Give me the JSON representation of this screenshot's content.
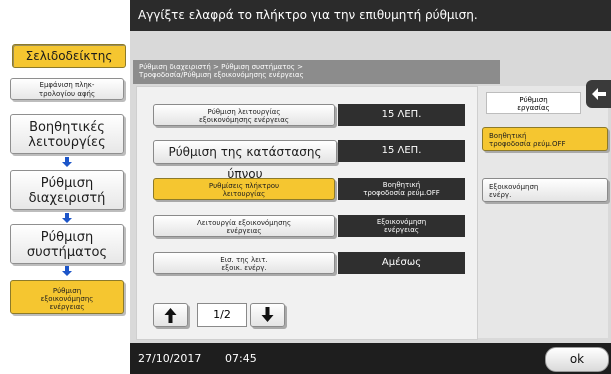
{
  "header": {
    "instruction": "Αγγίξτε ελαφρά το πλήκτρο για την επιθυμητή ρύθμιση."
  },
  "sidebar": {
    "bookmark_label": "Σελιδοδείκτης",
    "items": [
      {
        "label": "Εμφάνιση πληκ-\nτρολογίου αφής"
      },
      {
        "label": "Βοηθητικές\nλειτουργίες"
      },
      {
        "label": "Ρύθμιση\nδιαχειριστή"
      },
      {
        "label": "Ρύθμιση\nσυστήματος"
      },
      {
        "label": "Ρύθμιση\nεξοικονόμησης\nενέργειας"
      }
    ]
  },
  "breadcrumb": {
    "text": "Ρύθμιση διαχειριστή > Ρύθμιση συστήματος >\nΤροφοδοσία/Ρύθμιση εξοικονόμησης ενέργειας"
  },
  "settings": {
    "rows": [
      {
        "label": "Ρύθμιση λειτουργίας\nεξοικονόμησης ενέργειας",
        "value": "15 ΛΕΠ."
      },
      {
        "label": "Ρύθμιση της κατάστασης ύπνου",
        "value": "15 ΛΕΠ."
      },
      {
        "label": "Ρυθμίσεις πλήκτρου\nλειτουργίας",
        "value": "Βοηθητική\nτροφοδοσία ρεύμ.OFF"
      },
      {
        "label": "Λειτουργία εξοικονόμησης\nενέργειας",
        "value": "Εξοικονόμηση\nενέργειας"
      },
      {
        "label": "Εισ. της λειτ.\nεξοικ. ενέργ.",
        "value": "Αμέσως"
      }
    ]
  },
  "pager": {
    "page": "1/2"
  },
  "right_panel": {
    "label": "Ρύθμιση\nεργασίας",
    "options": [
      {
        "label": "Βοηθητική\nτροφοδοσία ρεύμ.OFF"
      },
      {
        "label": "Εξοικονόμηση\nενέργ."
      }
    ]
  },
  "footer": {
    "date": "27/10/2017",
    "time": "07:45",
    "ok_label": "ok"
  },
  "colors": {
    "accent": "#f5c630",
    "dark": "#2f2f2f",
    "panel": "#d9d9d9"
  }
}
